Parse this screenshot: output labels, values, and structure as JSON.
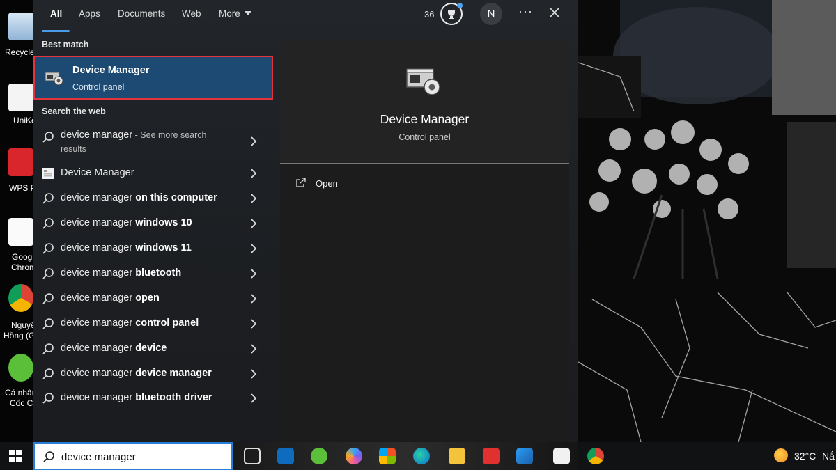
{
  "desktop": {
    "icons": [
      {
        "label": "Recycle"
      },
      {
        "label": "UniKe"
      },
      {
        "label": "WPS P"
      },
      {
        "label": "Goog"
      },
      {
        "label": "Chrom"
      },
      {
        "label": "Nguyê"
      },
      {
        "label": "Hồng (G"
      },
      {
        "label": "Cá nhân"
      },
      {
        "label": "Cốc Cố"
      }
    ]
  },
  "search_panel": {
    "tabs": [
      {
        "label": "All",
        "active": true
      },
      {
        "label": "Apps"
      },
      {
        "label": "Documents"
      },
      {
        "label": "Web"
      },
      {
        "label": "More"
      }
    ],
    "points": "36",
    "avatar_initial": "N",
    "more_options": "···",
    "best_match_title": "Best match",
    "best_match": {
      "title": "Device Manager",
      "subtitle": "Control panel",
      "icon": "device-manager-icon"
    },
    "web_section_title": "Search the web",
    "web_results": [
      {
        "query": "device manager",
        "suffix": " - See more search",
        "suffix2": "results",
        "icon": "search-icon"
      },
      {
        "query": "Device Manager",
        "suffix": "",
        "icon": "web-page-icon"
      },
      {
        "query": "device manager",
        "suffix": " on this computer",
        "icon": "search-icon"
      },
      {
        "query": "device manager",
        "suffix": " windows 10",
        "icon": "search-icon"
      },
      {
        "query": "device manager",
        "suffix": " windows 11",
        "icon": "search-icon"
      },
      {
        "query": "device manager",
        "suffix": " bluetooth",
        "icon": "search-icon"
      },
      {
        "query": "device manager",
        "suffix": " open",
        "icon": "search-icon"
      },
      {
        "query": "device manager",
        "suffix": " control panel",
        "icon": "search-icon"
      },
      {
        "query": "device manager",
        "suffix": " device",
        "icon": "search-icon"
      },
      {
        "query": "device manager",
        "suffix": " device manager",
        "icon": "search-icon"
      },
      {
        "query": "device manager",
        "suffix": " bluetooth driver",
        "icon": "search-icon"
      }
    ],
    "preview": {
      "title": "Device Manager",
      "subtitle": "Control panel",
      "open_label": "Open"
    }
  },
  "taskbar": {
    "search_value": "device manager",
    "temperature": "32°C",
    "weather_text": "Nắ"
  },
  "colors": {
    "accent": "#4c9be8",
    "best_match_bg": "#1d4a73",
    "highlight_border": "#e3343b",
    "taskbar_search_border": "#2a7dd6"
  }
}
